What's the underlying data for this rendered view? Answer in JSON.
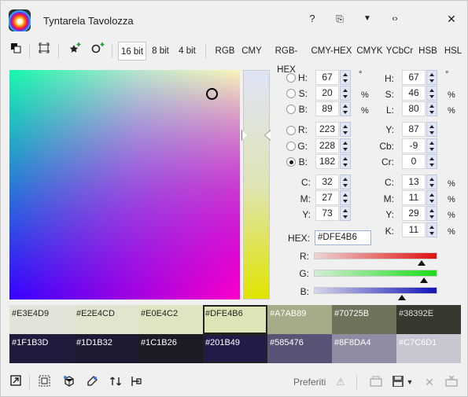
{
  "window": {
    "title": "Tyntarela Tavolozza",
    "controls": [
      "?",
      "⧉",
      "▾",
      "‹›",
      "✕"
    ]
  },
  "toolbar": {
    "bit_modes": [
      "16 bit",
      "8 bit",
      "4 bit"
    ],
    "selected_bit": "16 bit",
    "formats": [
      "RGB",
      "CMY",
      "RGB-HEX",
      "CMY-HEX",
      "CMYK",
      "YCbCr",
      "HSB",
      "HSL"
    ]
  },
  "picker": {
    "selected_hex": "#DFE4B6",
    "accent": "#dfe4b6"
  },
  "hsb": {
    "h": {
      "label": "H:",
      "value": "67",
      "unit": "°"
    },
    "s": {
      "label": "S:",
      "value": "20",
      "unit": "%"
    },
    "b": {
      "label": "B:",
      "value": "89",
      "unit": "%"
    }
  },
  "rgb": {
    "r": {
      "label": "R:",
      "value": "223"
    },
    "g": {
      "label": "G:",
      "value": "228"
    },
    "b": {
      "label": "B:",
      "value": "182"
    },
    "selected_channel": "B"
  },
  "cmy": {
    "c": {
      "label": "C:",
      "value": "32"
    },
    "m": {
      "label": "M:",
      "value": "27"
    },
    "y": {
      "label": "Y:",
      "value": "73"
    }
  },
  "hsl": {
    "h": {
      "label": "H:",
      "value": "67",
      "unit": "°"
    },
    "s": {
      "label": "S:",
      "value": "46",
      "unit": "%"
    },
    "l": {
      "label": "L:",
      "value": "80",
      "unit": "%"
    }
  },
  "ycbcr": {
    "y": {
      "label": "Y:",
      "value": "87"
    },
    "cb": {
      "label": "Cb:",
      "value": "-9"
    },
    "cr": {
      "label": "Cr:",
      "value": "0"
    }
  },
  "cmyk": {
    "c": {
      "label": "C:",
      "value": "13",
      "unit": "%"
    },
    "m": {
      "label": "M:",
      "value": "11",
      "unit": "%"
    },
    "y": {
      "label": "Y:",
      "value": "29",
      "unit": "%"
    },
    "k": {
      "label": "K:",
      "value": "11",
      "unit": "%"
    }
  },
  "hex": {
    "label": "HEX:",
    "value": "#DFE4B6"
  },
  "sliders": {
    "r": {
      "label": "R:",
      "fraction": 0.874,
      "color": "#e01010"
    },
    "g": {
      "label": "G:",
      "fraction": 0.894,
      "color": "#10e010"
    },
    "b": {
      "label": "B:",
      "fraction": 0.714,
      "color": "#1010c0"
    }
  },
  "swatches": {
    "row1": [
      {
        "hex": "#E3E4D9",
        "text_color": "#222"
      },
      {
        "hex": "#E2E4CD",
        "text_color": "#222"
      },
      {
        "hex": "#E0E4C2",
        "text_color": "#222"
      },
      {
        "hex": "#DFE4B6",
        "text_color": "#222",
        "selected": true
      },
      {
        "hex": "#A7AB89",
        "text_color": "#ffffff"
      },
      {
        "hex": "#70725B",
        "text_color": "#ffffff"
      },
      {
        "hex": "#38392E",
        "text_color": "#dddddd"
      }
    ],
    "row2": [
      {
        "hex": "#1F1B3D",
        "text_color": "#ffffff"
      },
      {
        "hex": "#1D1B32",
        "text_color": "#ffffff"
      },
      {
        "hex": "#1C1B26",
        "text_color": "#ffffff"
      },
      {
        "hex": "#201B49",
        "text_color": "#ffffff",
        "selected": true
      },
      {
        "hex": "#585476",
        "text_color": "#ffffff"
      },
      {
        "hex": "#8F8DA4",
        "text_color": "#ffffff"
      },
      {
        "hex": "#C7C6D1",
        "text_color": "#ffffff"
      }
    ]
  },
  "bottom": {
    "favorites_label": "Preferiti"
  }
}
